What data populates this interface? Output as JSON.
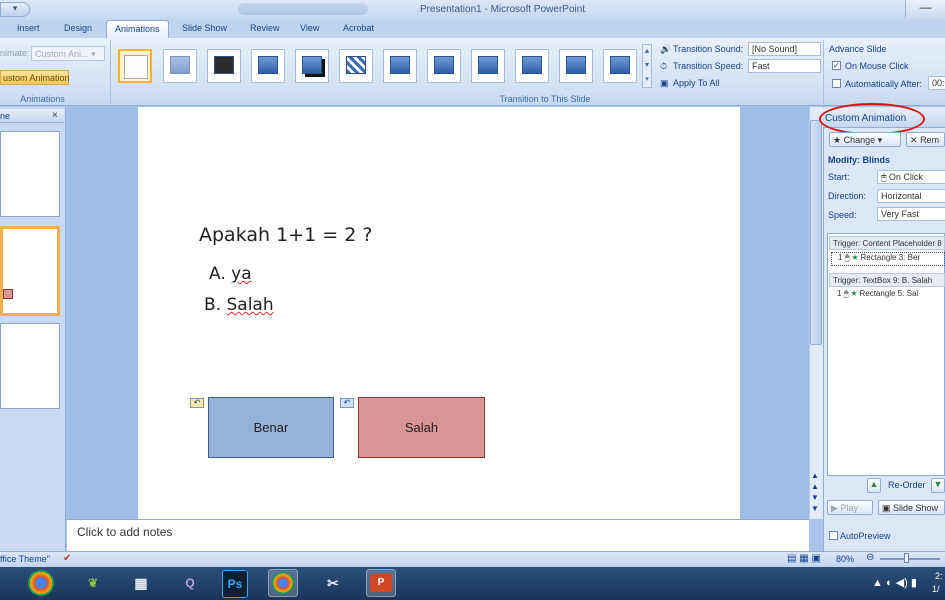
{
  "window": {
    "title": "Presentation1 - Microsoft PowerPoint",
    "minimize_glyph": "—"
  },
  "tabs": [
    {
      "label": "Insert"
    },
    {
      "label": "Design"
    },
    {
      "label": "Animations",
      "active": true
    },
    {
      "label": "Slide Show"
    },
    {
      "label": "Review"
    },
    {
      "label": "View"
    },
    {
      "label": "Acrobat"
    }
  ],
  "ribbon": {
    "animations_group": {
      "animate_label": "nimate:",
      "animate_value": "Custom Ani...",
      "custom_animation_button": "ustom Animation",
      "group_label": "Animations"
    },
    "transition_group": {
      "sound_label": "Transition Sound:",
      "sound_value": "[No Sound]",
      "speed_label": "Transition Speed:",
      "speed_value": "Fast",
      "apply_all": "Apply To All",
      "group_label": "Transition to This Slide"
    },
    "advance_group": {
      "title": "Advance Slide",
      "on_mouse_click": "On Mouse Click",
      "on_mouse_click_checked": true,
      "auto_after": "Automatically After:",
      "auto_after_value": "00:0"
    }
  },
  "left_pane": {
    "tab_label": "ne",
    "close": "×"
  },
  "slide": {
    "question": "Apakah 1+1 = 2 ?",
    "option_a_prefix": "A. ",
    "option_a_word": "ya",
    "option_b_prefix": "B. ",
    "option_b_word": "Salah",
    "box_benar": "Benar",
    "box_salah": "Salah"
  },
  "notes": {
    "placeholder": "Click to add notes"
  },
  "task_pane": {
    "title": "Custom Animation",
    "change_button": "Change",
    "remove_button": "Rem",
    "modify_label": "Modify: Blinds",
    "start_label": "Start:",
    "start_value": "On Click",
    "direction_label": "Direction:",
    "direction_value": "Horizontal",
    "speed_label": "Speed:",
    "speed_value": "Very Fast",
    "triggers": [
      {
        "header": "Trigger: Content Placeholder 8",
        "item_num": "1",
        "item": "Rectangle 3: Ber"
      },
      {
        "header": "Trigger: TextBox 9: B. Salah",
        "item_num": "1",
        "item": "Rectangle 5: Sal"
      }
    ],
    "reorder_label": "Re-Order",
    "play_button": "Play",
    "slideshow_button": "Slide Show",
    "autopreview": "AutoPreview"
  },
  "status_bar": {
    "theme": "ffice Theme\"",
    "zoom": "80%"
  },
  "taskbar": {
    "clock_time": "2:",
    "clock_date": "1/",
    "tray_glyphs": "▲ ◐ ◀) ▮"
  },
  "colors": {
    "benar_fill": "#95b3d7",
    "salah_fill": "#d99694",
    "highlight_ellipse": "#e01010",
    "ribbon_text": "#15428b"
  }
}
